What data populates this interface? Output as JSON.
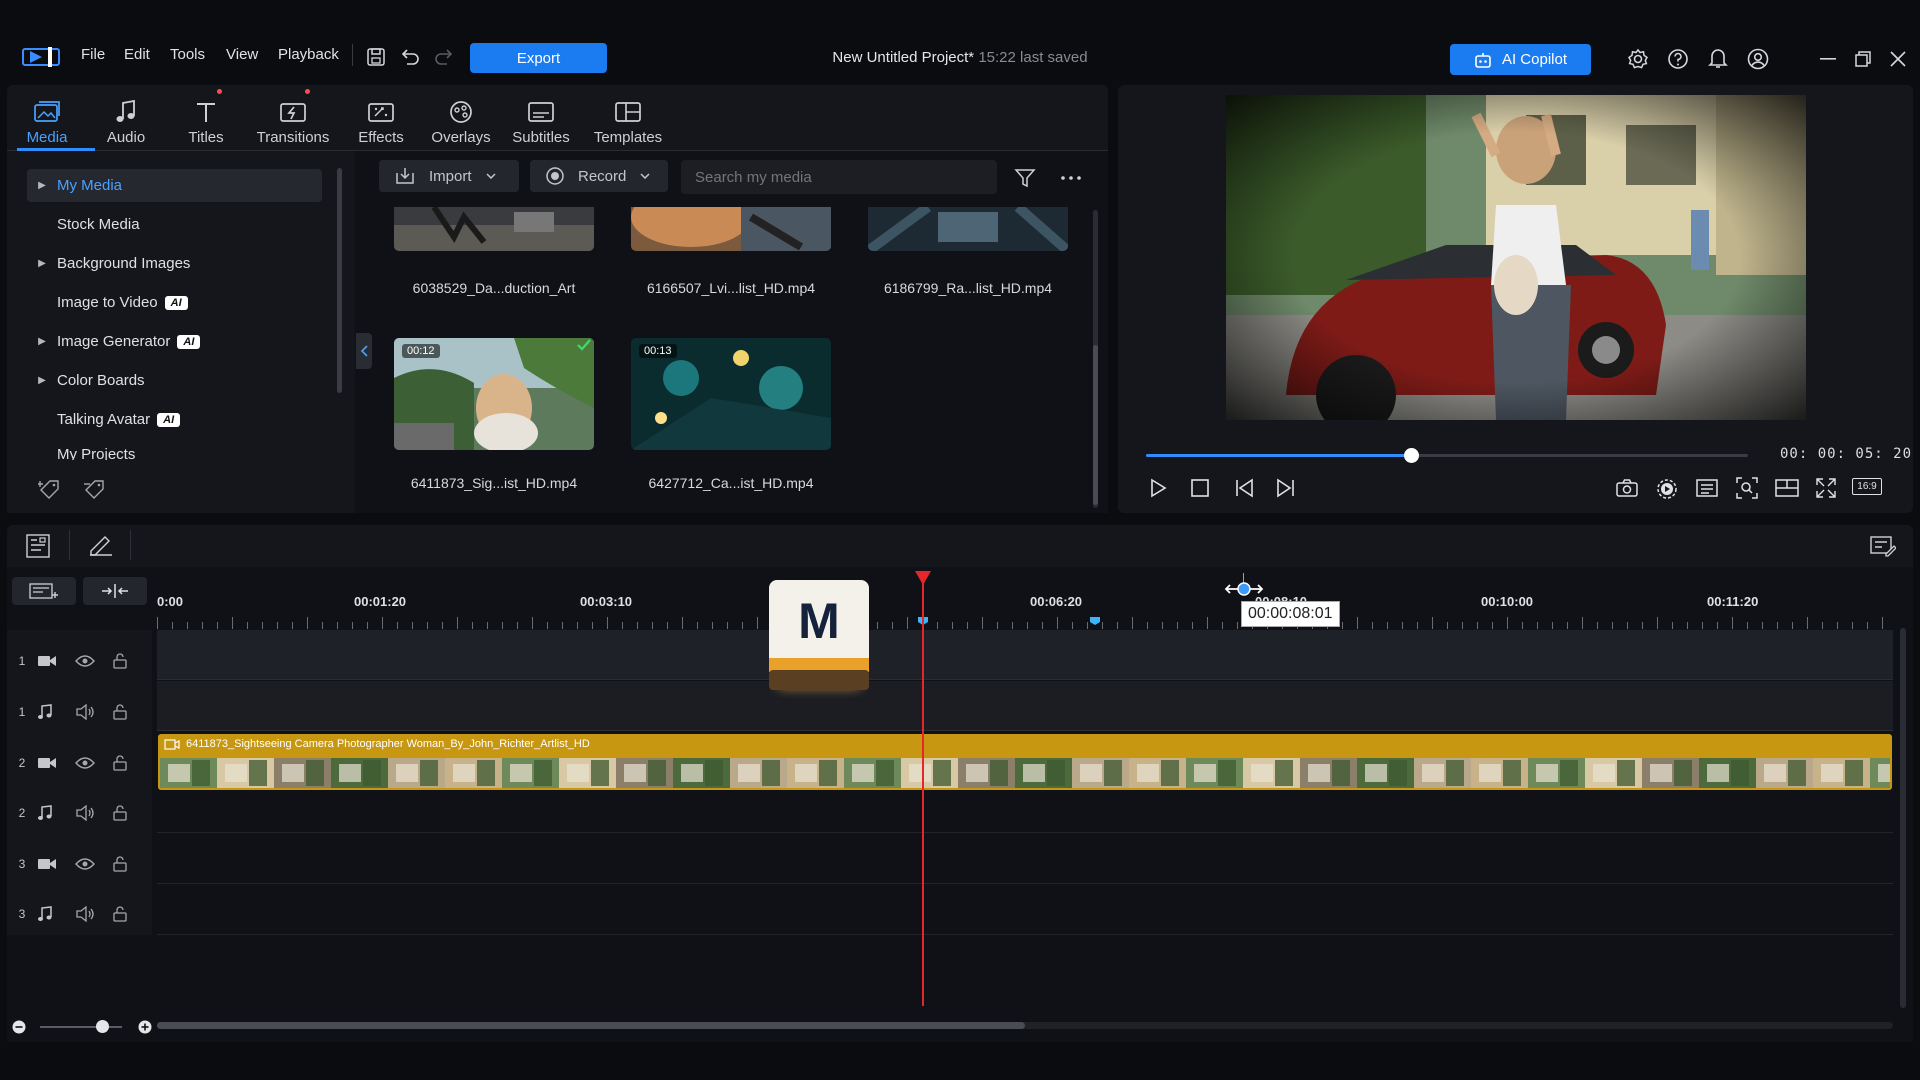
{
  "menu": [
    "File",
    "Edit",
    "Tools",
    "View",
    "Playback"
  ],
  "export_label": "Export",
  "project": {
    "title": "New Untitled Project*",
    "saved": "15:22 last saved"
  },
  "ai_copilot_label": "AI Copilot",
  "tabs": [
    {
      "label": "Media",
      "icon": "media-icon"
    },
    {
      "label": "Audio",
      "icon": "music-note-icon"
    },
    {
      "label": "Titles",
      "icon": "title-icon"
    },
    {
      "label": "Transitions",
      "icon": "transitions-icon"
    },
    {
      "label": "Effects",
      "icon": "effects-icon"
    },
    {
      "label": "Overlays",
      "icon": "overlays-icon"
    },
    {
      "label": "Subtitles",
      "icon": "subtitles-icon"
    },
    {
      "label": "Templates",
      "icon": "templates-icon"
    }
  ],
  "sidebar": [
    {
      "label": "My Media",
      "arrow": "▶",
      "ai": ""
    },
    {
      "label": "Stock Media",
      "arrow": "",
      "ai": ""
    },
    {
      "label": "Background Images",
      "arrow": "▶",
      "ai": ""
    },
    {
      "label": "Image to Video",
      "arrow": "",
      "ai": "AI"
    },
    {
      "label": "Image Generator",
      "arrow": "▶",
      "ai": "AI"
    },
    {
      "label": "Color Boards",
      "arrow": "▶",
      "ai": ""
    },
    {
      "label": "Talking Avatar",
      "arrow": "",
      "ai": "AI"
    },
    {
      "label": "My Projects",
      "arrow": "",
      "ai": ""
    }
  ],
  "toolbar": {
    "import": "Import",
    "record": "Record",
    "search_placeholder": "Search my media"
  },
  "media": [
    {
      "name": "6038529_Da...duction_Art",
      "duration": ""
    },
    {
      "name": "6166507_Lvi...list_HD.mp4",
      "duration": ""
    },
    {
      "name": "6186799_Ra...list_HD.mp4",
      "duration": ""
    },
    {
      "name": "6411873_Sig...ist_HD.mp4",
      "duration": "00:12"
    },
    {
      "name": "6427712_Ca...ist_HD.mp4",
      "duration": "00:13"
    }
  ],
  "preview": {
    "timecode": "00: 00: 05: 20",
    "progress": 0.44,
    "aspect": "16:9"
  },
  "ruler": [
    "0:00",
    "00:01:20",
    "00:03:10",
    "00:06:20",
    "00:08:10",
    "00:10:00",
    "00:11:20"
  ],
  "tooltip": "00:00:08:01",
  "badge_letter": "M",
  "tracks": [
    {
      "num": "1",
      "type": "video"
    },
    {
      "num": "1",
      "type": "audio"
    },
    {
      "num": "2",
      "type": "video"
    },
    {
      "num": "2",
      "type": "audio"
    },
    {
      "num": "3",
      "type": "video"
    },
    {
      "num": "3",
      "type": "audio"
    }
  ],
  "clip_label": "6411873_Sightseeing Camera Photographer Woman_By_John_Richter_Artlist_HD",
  "colors": {
    "accent": "#1a7cf0",
    "playhead": "#e5262b",
    "clip": "#c79711"
  }
}
